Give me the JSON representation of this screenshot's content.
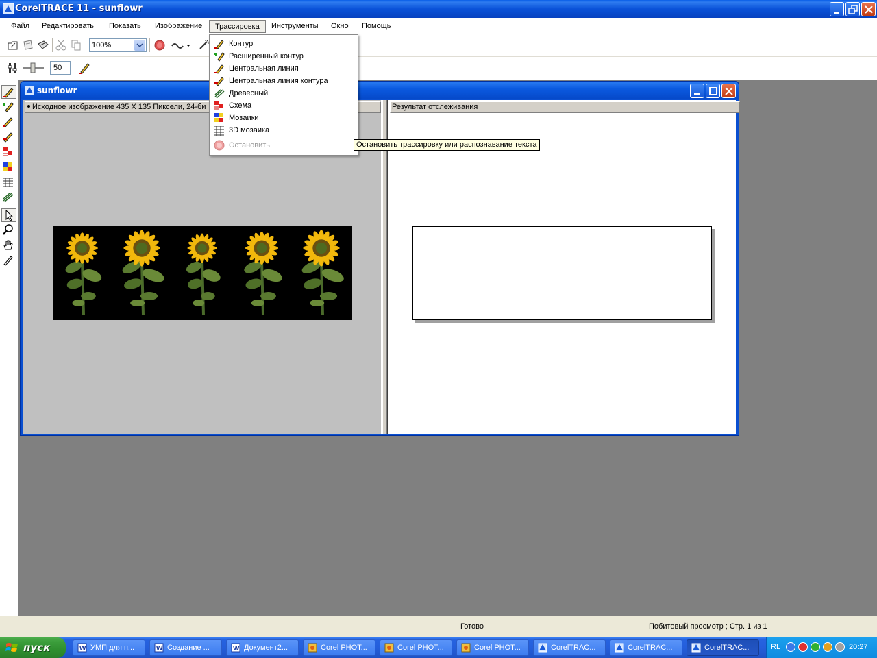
{
  "app": {
    "title": "CorelTRACE 11 - sunflowr"
  },
  "menubar": {
    "items": [
      "Файл",
      "Редактировать",
      "Показать",
      "Изображение",
      "Трассировка",
      "Инструменты",
      "Окно",
      "Помощь"
    ],
    "active": "Трассировка"
  },
  "toolbar": {
    "zoom_value": "100%",
    "detail_value": "50"
  },
  "document": {
    "title": "sunflowr",
    "source_header": "Исходное изображение   435 X 135 Пиксели, 24-би",
    "result_header": "Результат отслеживания"
  },
  "trace_menu": {
    "items": [
      {
        "label": "Контур",
        "icon": "outline-trace-icon"
      },
      {
        "label": "Расширенный контур",
        "icon": "advanced-outline-icon"
      },
      {
        "label": "Центральная линия",
        "icon": "centerline-icon"
      },
      {
        "label": "Центральная линия контура",
        "icon": "outline-centerline-icon"
      },
      {
        "label": "Древесный",
        "icon": "woodcut-icon"
      },
      {
        "label": "Схема",
        "icon": "sketch-icon"
      },
      {
        "label": "Мозаики",
        "icon": "mosaic-icon"
      },
      {
        "label": "3D мозаика",
        "icon": "mosaic-3d-icon"
      }
    ],
    "stop_label": "Остановить",
    "stop_disabled": true
  },
  "tooltip": {
    "text": "Остановить трассировку или распознавание текста"
  },
  "statusbar": {
    "ready": "Готово",
    "view": "Побитовый просмотр ; Стр. 1 из 1"
  },
  "taskbar": {
    "start_label": "пуск",
    "tasks": [
      {
        "label": "УМП для п...",
        "icon": "word-icon",
        "active": false
      },
      {
        "label": "Создание ...",
        "icon": "word-icon",
        "active": false
      },
      {
        "label": "Документ2...",
        "icon": "word-icon",
        "active": false
      },
      {
        "label": "Corel PHOT...",
        "icon": "corel-photo-icon",
        "active": false
      },
      {
        "label": "Corel PHOT...",
        "icon": "corel-photo-icon",
        "active": false
      },
      {
        "label": "Corel PHOT...",
        "icon": "corel-photo-icon",
        "active": false
      },
      {
        "label": "CorelTRAC...",
        "icon": "coreltrace-icon",
        "active": false
      },
      {
        "label": "CorelTRAC...",
        "icon": "coreltrace-icon",
        "active": false
      },
      {
        "label": "CorelTRAC...",
        "icon": "coreltrace-icon",
        "active": true
      }
    ],
    "lang": "RL",
    "clock": "20:27"
  },
  "colors": {
    "xp_blue": "#0a52d8",
    "start_green": "#3c9e3c",
    "tooltip_bg": "#ffffe1",
    "menu_highlight": "#f0efe9"
  }
}
